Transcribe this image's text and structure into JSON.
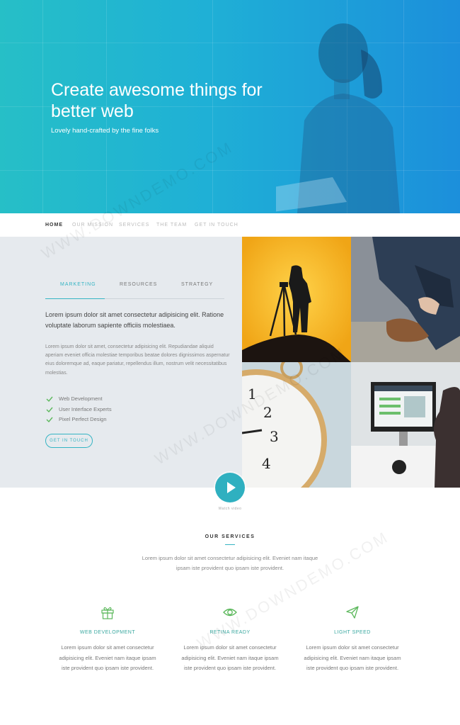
{
  "hero": {
    "title": "Create awesome things for better web",
    "subtitle": "Lovely hand-crafted by the fine folks"
  },
  "nav": {
    "items": [
      "HOME",
      "OUR MISSION",
      "SERVICES",
      "THE TEAM",
      "GET IN TOUCH"
    ],
    "active": "HOME"
  },
  "content": {
    "tabs": [
      "MARKETING",
      "RESOURCES",
      "STRATEGY"
    ],
    "active_tab": "MARKETING",
    "lead": "Lorem ipsum dolor sit amet consectetur adipisicing elit. Ratione voluptate laborum sapiente officiis molestiaea.",
    "body": "Lorem ipsum dolor sit amet, consectetur adipisicing elit. Repudiandae aliquid aperiam eveniet officia molestiae temporibus beatae dolores dignissimos aspernatur eius doloremque ad, eaque pariatur, repellendus illum, nostrum velit necessitatibus molestias.",
    "checklist": [
      "Web Development",
      "User Interface Experts",
      "Pixel Perfect Design"
    ],
    "button": "GET IN TOUCH"
  },
  "video": {
    "label": "Watch video"
  },
  "services": {
    "title": "OUR SERVICES",
    "intro": "Lorem ipsum dolor sit amet consectetur adipisicing elit. Eveniet nam itaque ipsam iste provident quo ipsam iste provident.",
    "items": [
      {
        "icon": "gift-icon",
        "name": "WEB DEVELOPMENT",
        "desc": "Lorem ipsum dolor sit amet consectetur adipisicing elit. Eveniet nam itaque ipsam iste provident quo ipsam iste provident."
      },
      {
        "icon": "eye-icon",
        "name": "RETINA READY",
        "desc": "Lorem ipsum dolor sit amet consectetur adipisicing elit. Eveniet nam itaque ipsam iste provident quo ipsam iste provident."
      },
      {
        "icon": "paper-plane-icon",
        "name": "LIGHT SPEED",
        "desc": "Lorem ipsum dolor sit amet consectetur adipisicing elit. Eveniet nam itaque ipsam iste provident quo ipsam iste provident."
      }
    ]
  },
  "watermark": "WWW.DOWNDEMO.COM",
  "colors": {
    "accent": "#35b4c3",
    "green": "#5cb85c",
    "hero_start": "#26bfc7",
    "hero_end": "#1c8fdb"
  }
}
